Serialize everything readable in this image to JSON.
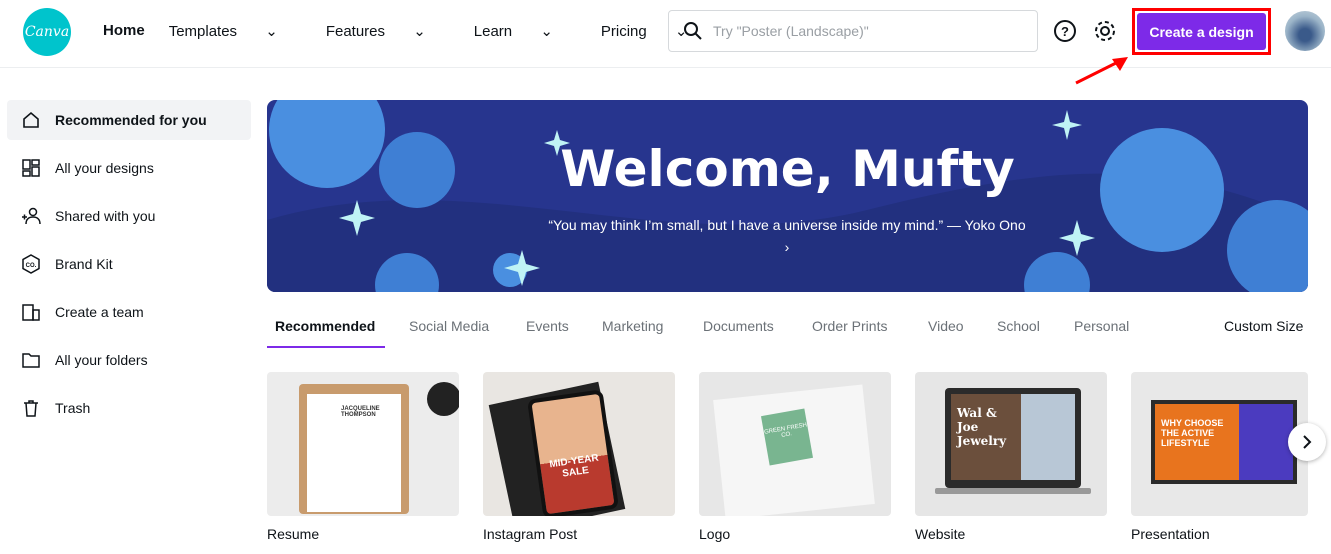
{
  "header": {
    "logo": "Canva",
    "nav": [
      {
        "label": "Home"
      },
      {
        "label": "Templates"
      },
      {
        "label": "Features"
      },
      {
        "label": "Learn"
      },
      {
        "label": "Pricing"
      }
    ],
    "search_placeholder": "Try \"Poster (Landscape)\"",
    "create_label": "Create a design",
    "accent": "#7d2ae8"
  },
  "sidebar": {
    "items": [
      {
        "label": "Recommended for you",
        "icon": "home-icon"
      },
      {
        "label": "All your designs",
        "icon": "grid-icon"
      },
      {
        "label": "Shared with you",
        "icon": "users-icon"
      },
      {
        "label": "Brand Kit",
        "icon": "brand-icon"
      },
      {
        "label": "Create a team",
        "icon": "building-icon"
      },
      {
        "label": "All your folders",
        "icon": "folder-icon"
      },
      {
        "label": "Trash",
        "icon": "trash-icon"
      }
    ]
  },
  "banner": {
    "title": "Welcome, Mufty",
    "quote": "“You may think I’m small, but I have a universe inside my mind.” — Yoko Ono ›"
  },
  "tabs": [
    {
      "label": "Recommended"
    },
    {
      "label": "Social Media"
    },
    {
      "label": "Events"
    },
    {
      "label": "Marketing"
    },
    {
      "label": "Documents"
    },
    {
      "label": "Order Prints"
    },
    {
      "label": "Video"
    },
    {
      "label": "School"
    },
    {
      "label": "Personal"
    }
  ],
  "custom_size": "Custom Size",
  "cards": [
    {
      "label": "Resume",
      "thumb": "JACQUELINE THOMPSON"
    },
    {
      "label": "Instagram Post",
      "thumb": "MID-YEAR SALE"
    },
    {
      "label": "Logo",
      "thumb": "GREEN FRESH CO."
    },
    {
      "label": "Website",
      "thumb": "Wal & Joe Jewelry"
    },
    {
      "label": "Presentation",
      "thumb": "WHY CHOOSE THE ACTIVE LIFESTYLE"
    }
  ]
}
